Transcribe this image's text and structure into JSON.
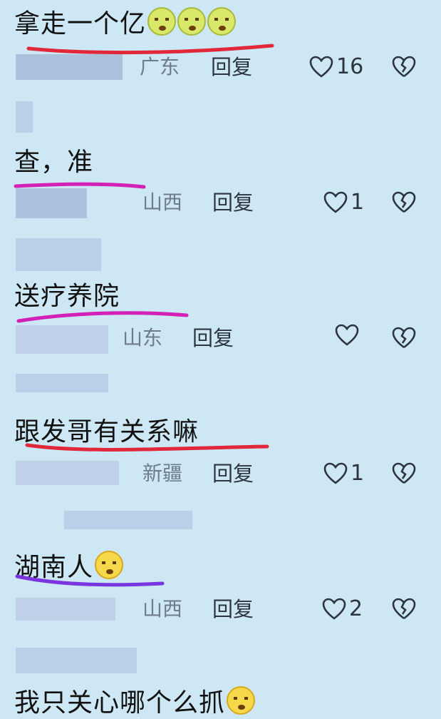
{
  "comments": [
    {
      "text": "拿走一个亿",
      "location": "广东",
      "reply": "回复",
      "likes": "16"
    },
    {
      "text": "查，准",
      "location": "山西",
      "reply": "回复",
      "likes": "1"
    },
    {
      "text": "送疗养院",
      "location": "山东",
      "reply": "回复",
      "likes": ""
    },
    {
      "text": "跟发哥有关系嘛",
      "location": "新疆",
      "reply": "回复",
      "likes": "1"
    },
    {
      "text": "湖南人",
      "location": "山西",
      "reply": "回复",
      "likes": "2"
    },
    {
      "text": "我只关心哪个么抓",
      "location": "",
      "reply": "",
      "likes": ""
    }
  ],
  "colors": {
    "underline_red": "#e0283a",
    "underline_pink": "#d321b8",
    "underline_purple": "#7a35e0"
  },
  "icons": [
    "heart-icon",
    "broken-heart-icon",
    "emoji-sick-icon",
    "emoji-sweat-smile-icon",
    "emoji-laugh-icon"
  ]
}
